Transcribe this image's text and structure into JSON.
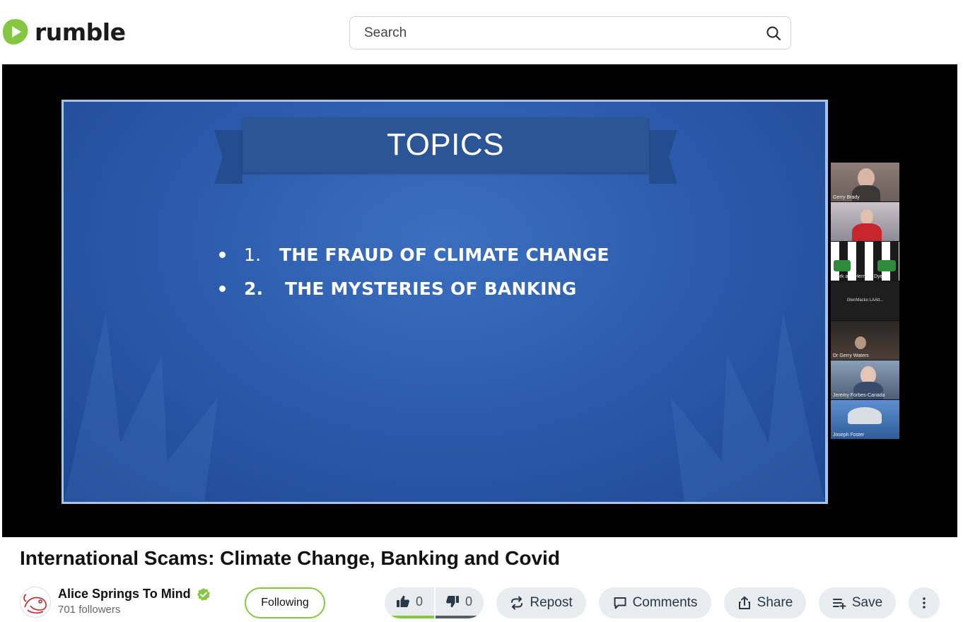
{
  "header": {
    "logo_text": "rumble",
    "search_placeholder": "Search"
  },
  "slide": {
    "title": "TOPICS",
    "bullets": [
      {
        "num": "1.",
        "text": "THE FRAUD OF CLIMATE CHANGE"
      },
      {
        "num": "2.",
        "text": "THE MYSTERIES OF BANKING"
      }
    ]
  },
  "participants": [
    {
      "name": "Gerry Brady"
    },
    {
      "name": ""
    },
    {
      "name": "Merk and Herman Dyer"
    },
    {
      "name": "GlenMacko LAAtt..."
    },
    {
      "name": "Dr Gerry Waters"
    },
    {
      "name": "Jeremy Forbes-Canada"
    },
    {
      "name": "Joseph Foster"
    }
  ],
  "video": {
    "title": "International Scams: Climate Change, Banking and Covid"
  },
  "channel": {
    "name": "Alice Springs To Mind",
    "followers": "701 followers",
    "follow_label": "Following"
  },
  "actions": {
    "likes": "0",
    "dislikes": "0",
    "repost": "Repost",
    "comments": "Comments",
    "share": "Share",
    "save": "Save"
  },
  "colors": {
    "brand": "#85c742",
    "pill_bg": "#e8ecef",
    "slide_blue": "#2a58a8"
  }
}
